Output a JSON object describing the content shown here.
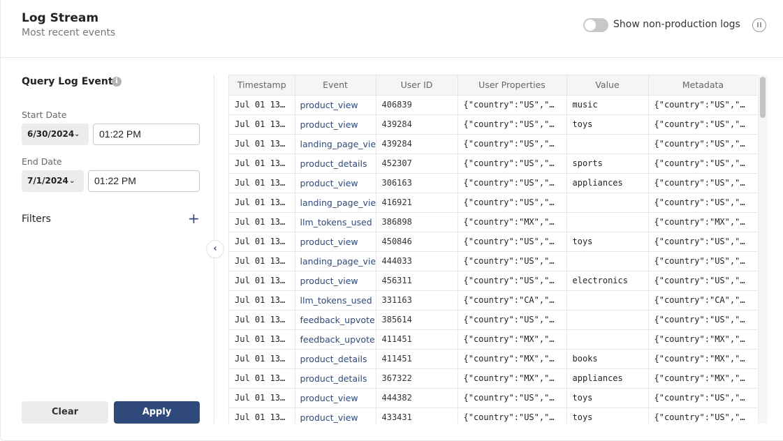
{
  "header": {
    "title": "Log Stream",
    "subtitle": "Most recent events",
    "toggle_label": "Show non-production logs",
    "toggle_on": false
  },
  "query": {
    "title": "Query Log Events",
    "info_icon": "info-icon",
    "start_label": "Start Date",
    "start_date": "6/30/2024",
    "start_time": "01:22 PM",
    "end_label": "End Date",
    "end_date": "7/1/2024",
    "end_time": "01:22 PM",
    "filters_label": "Filters",
    "add_filter_icon": "+",
    "collapse_icon": "‹",
    "clear_label": "Clear",
    "apply_label": "Apply"
  },
  "colors": {
    "accent": "#2f4a7a",
    "border": "#e6e6e6",
    "header_bg": "#f5f5f5"
  },
  "table": {
    "columns": [
      "Timestamp",
      "Event",
      "User ID",
      "User Properties",
      "Value",
      "Metadata"
    ],
    "rows": [
      {
        "ts": "Jul 01 13…",
        "event": "product_view",
        "uid": "406839",
        "props": "{\"country\":\"US\",\"…",
        "value": "music",
        "meta": "{\"country\":\"US\",\"…"
      },
      {
        "ts": "Jul 01 13…",
        "event": "product_view",
        "uid": "439284",
        "props": "{\"country\":\"US\",\"…",
        "value": "toys",
        "meta": "{\"country\":\"US\",\"…"
      },
      {
        "ts": "Jul 01 13…",
        "event": "landing_page_view",
        "uid": "439284",
        "props": "{\"country\":\"US\",\"…",
        "value": "",
        "meta": "{\"country\":\"US\",\"…"
      },
      {
        "ts": "Jul 01 13…",
        "event": "product_details",
        "uid": "452307",
        "props": "{\"country\":\"US\",\"…",
        "value": "sports",
        "meta": "{\"country\":\"US\",\"…"
      },
      {
        "ts": "Jul 01 13…",
        "event": "product_view",
        "uid": "306163",
        "props": "{\"country\":\"US\",\"…",
        "value": "appliances",
        "meta": "{\"country\":\"US\",\"…"
      },
      {
        "ts": "Jul 01 13…",
        "event": "landing_page_view",
        "uid": "416921",
        "props": "{\"country\":\"US\",\"…",
        "value": "",
        "meta": "{\"country\":\"US\",\"…"
      },
      {
        "ts": "Jul 01 13…",
        "event": "llm_tokens_used",
        "uid": "386898",
        "props": "{\"country\":\"MX\",\"…",
        "value": "",
        "meta": "{\"country\":\"MX\",\"…"
      },
      {
        "ts": "Jul 01 13…",
        "event": "product_view",
        "uid": "450846",
        "props": "{\"country\":\"US\",\"…",
        "value": "toys",
        "meta": "{\"country\":\"US\",\"…"
      },
      {
        "ts": "Jul 01 13…",
        "event": "landing_page_view",
        "uid": "444033",
        "props": "{\"country\":\"US\",\"…",
        "value": "",
        "meta": "{\"country\":\"US\",\"…"
      },
      {
        "ts": "Jul 01 13…",
        "event": "product_view",
        "uid": "456311",
        "props": "{\"country\":\"US\",\"…",
        "value": "electronics",
        "meta": "{\"country\":\"US\",\"…"
      },
      {
        "ts": "Jul 01 13…",
        "event": "llm_tokens_used",
        "uid": "331163",
        "props": "{\"country\":\"CA\",\"…",
        "value": "",
        "meta": "{\"country\":\"CA\",\"…"
      },
      {
        "ts": "Jul 01 13…",
        "event": "feedback_upvote",
        "uid": "385614",
        "props": "{\"country\":\"US\",\"…",
        "value": "",
        "meta": "{\"country\":\"US\",\"…"
      },
      {
        "ts": "Jul 01 13…",
        "event": "feedback_upvote",
        "uid": "411451",
        "props": "{\"country\":\"MX\",\"…",
        "value": "",
        "meta": "{\"country\":\"MX\",\"…"
      },
      {
        "ts": "Jul 01 13…",
        "event": "product_details",
        "uid": "411451",
        "props": "{\"country\":\"MX\",\"…",
        "value": "books",
        "meta": "{\"country\":\"MX\",\"…"
      },
      {
        "ts": "Jul 01 13…",
        "event": "product_details",
        "uid": "367322",
        "props": "{\"country\":\"MX\",\"…",
        "value": "appliances",
        "meta": "{\"country\":\"MX\",\"…"
      },
      {
        "ts": "Jul 01 13…",
        "event": "product_view",
        "uid": "444382",
        "props": "{\"country\":\"US\",\"…",
        "value": "toys",
        "meta": "{\"country\":\"US\",\"…"
      },
      {
        "ts": "Jul 01 13…",
        "event": "product_view",
        "uid": "433431",
        "props": "{\"country\":\"US\",\"…",
        "value": "toys",
        "meta": "{\"country\":\"US\",\"…"
      }
    ]
  }
}
